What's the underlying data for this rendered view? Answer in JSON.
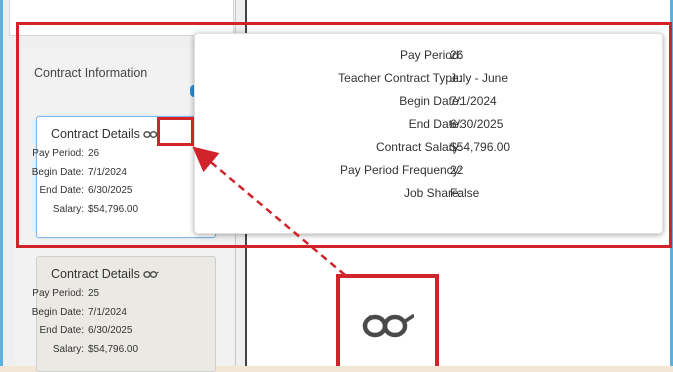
{
  "left_panel": {
    "section_title": "Contract Information"
  },
  "cards": [
    {
      "title": "Contract Details",
      "fields": [
        {
          "label": "Pay Period:",
          "value": "26"
        },
        {
          "label": "Begin Date:",
          "value": "7/1/2024"
        },
        {
          "label": "End Date:",
          "value": "6/30/2025"
        },
        {
          "label": "Salary:",
          "value": "$54,796.00"
        }
      ]
    },
    {
      "title": "Contract Details",
      "fields": [
        {
          "label": "Pay Period:",
          "value": "25"
        },
        {
          "label": "Begin Date:",
          "value": "7/1/2024"
        },
        {
          "label": "End Date:",
          "value": "6/30/2025"
        },
        {
          "label": "Salary:",
          "value": "$54,796.00"
        }
      ]
    }
  ],
  "tooltip": {
    "rows": [
      {
        "label": "Pay Period:",
        "value": "26"
      },
      {
        "label": "Teacher Contract Type:",
        "value": "July - June"
      },
      {
        "label": "Begin Date:",
        "value": "7/1/2024"
      },
      {
        "label": "End Date:",
        "value": "6/30/2025"
      },
      {
        "label": "Contract Salary:",
        "value": "$54,796.00"
      },
      {
        "label": "Pay Period Frequency:",
        "value": "22"
      },
      {
        "label": "Job Share:",
        "value": "False"
      }
    ]
  },
  "icons": {
    "details_icon": "glasses-icon"
  },
  "colors": {
    "highlight_red": "#d1232a",
    "frame_blue": "#5bb1e0",
    "accent_blue": "#2a8fd6"
  }
}
